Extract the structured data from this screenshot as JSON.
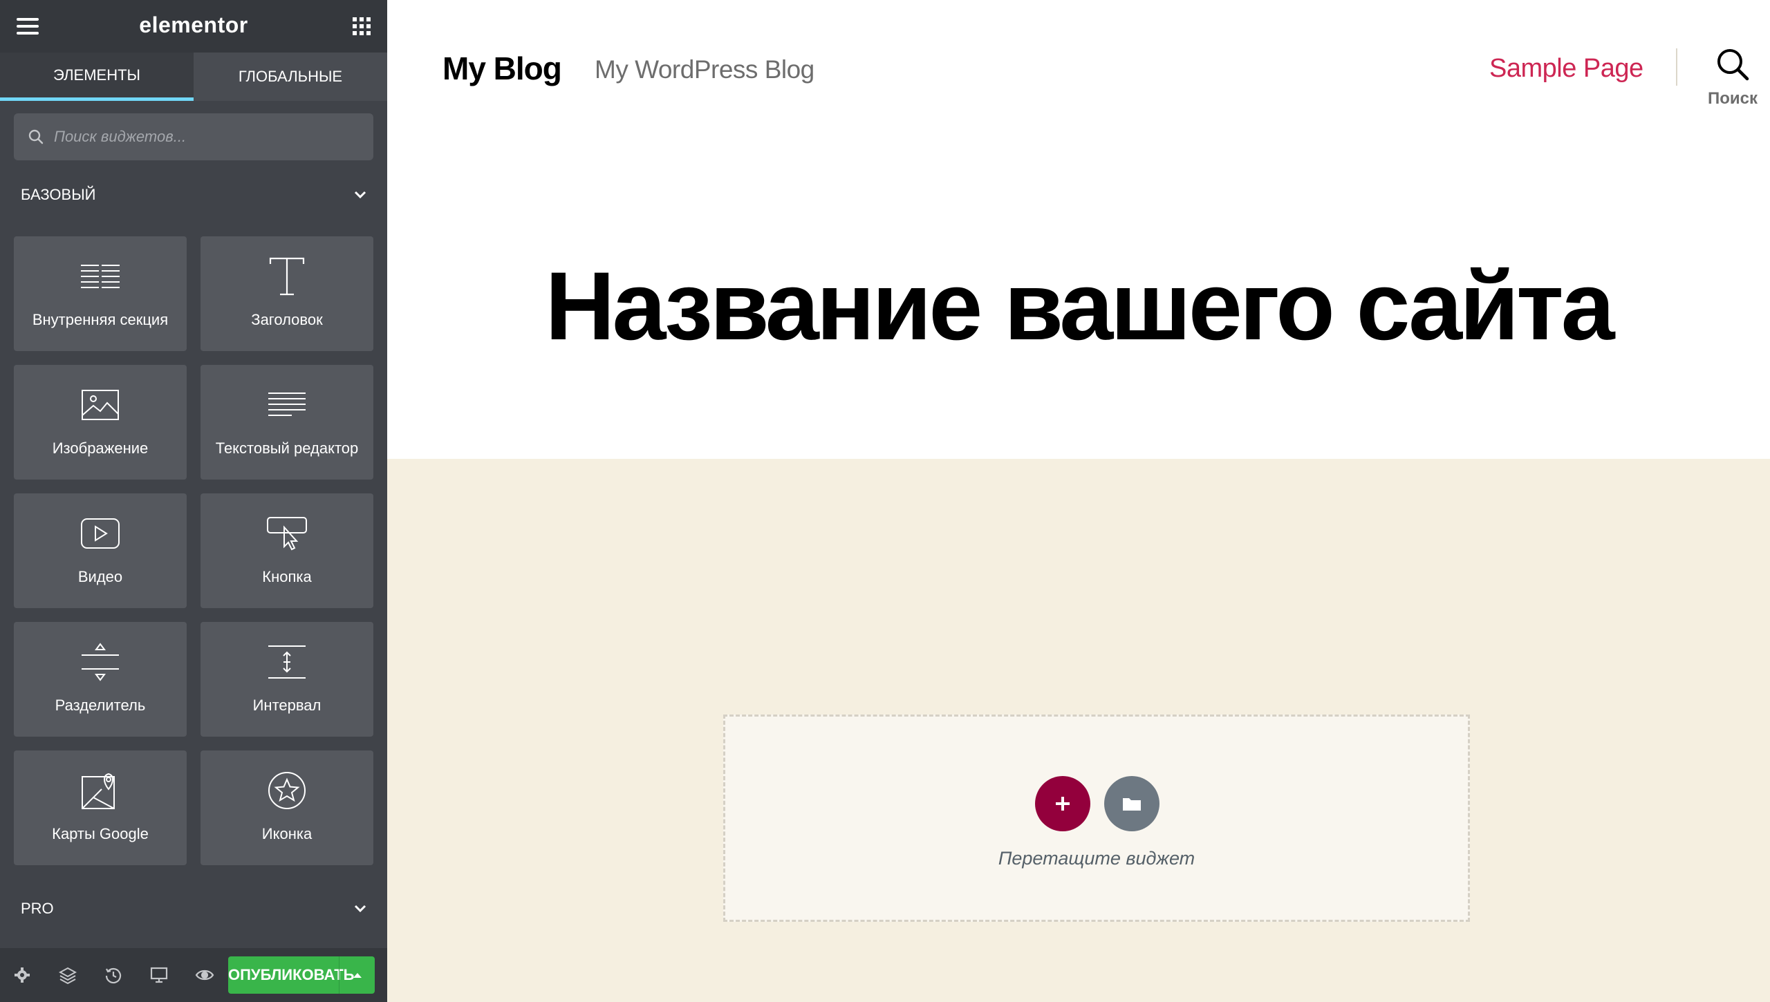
{
  "editor": {
    "logo": "elementor",
    "tabs": [
      {
        "label": "ЭЛЕМЕНТЫ",
        "active": true
      },
      {
        "label": "ГЛОБАЛЬНЫЕ",
        "active": false
      }
    ],
    "search": {
      "placeholder": "Поиск виджетов..."
    },
    "categories": [
      {
        "label": "БАЗОВЫЙ",
        "expanded": true
      },
      {
        "label": "PRO",
        "expanded": false
      }
    ],
    "widgets": [
      {
        "label": "Внутренняя секция",
        "icon": "inner-section-icon"
      },
      {
        "label": "Заголовок",
        "icon": "heading-icon"
      },
      {
        "label": "Изображение",
        "icon": "image-icon"
      },
      {
        "label": "Текстовый редактор",
        "icon": "text-editor-icon"
      },
      {
        "label": "Видео",
        "icon": "video-icon"
      },
      {
        "label": "Кнопка",
        "icon": "button-icon"
      },
      {
        "label": "Разделитель",
        "icon": "divider-icon"
      },
      {
        "label": "Интервал",
        "icon": "spacer-icon"
      },
      {
        "label": "Карты Google",
        "icon": "google-maps-icon"
      },
      {
        "label": "Иконка",
        "icon": "star-icon"
      }
    ],
    "footer": {
      "icons": [
        "settings-icon",
        "navigator-icon",
        "history-icon",
        "responsive-icon",
        "preview-icon"
      ],
      "publish_label": "ОПУБЛИКОВАТЬ"
    }
  },
  "site": {
    "title": "My Blog",
    "description": "My WordPress Blog",
    "menu_item": "Sample Page",
    "search_label": "Поиск",
    "hero_title": "Название вашего сайта",
    "dropzone_text": "Перетащите виджет"
  },
  "colors": {
    "panel": "#404349",
    "panel_dark": "#35383d",
    "tab_accent": "#71d7f7",
    "publish": "#39b54a",
    "link": "#cd2653",
    "add_button": "#93003c",
    "library_button": "#6d7882",
    "content_bg": "#f5efe0"
  }
}
